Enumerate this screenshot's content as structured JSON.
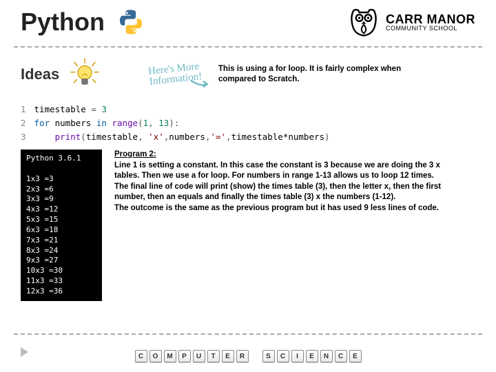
{
  "header": {
    "title": "Python",
    "school": {
      "name": "CARR MANOR",
      "sub": "COMMUNITY SCHOOL"
    }
  },
  "ideas": {
    "label": "Ideas",
    "more_info_line1": "Here's More",
    "more_info_line2": "Information!"
  },
  "note": "This is using a for loop. It is fairly complex when compared to Scratch.",
  "code": {
    "gutter": "1\n2\n3",
    "l1_id": "timestable",
    "l1_eq": " = ",
    "l1_num": "3",
    "l2_for": "for",
    "l2_var": " numbers ",
    "l2_in": "in",
    "l2_sp": " ",
    "l2_range": "range",
    "l2_open": "(",
    "l2_a": "1",
    "l2_comma": ", ",
    "l2_b": "13",
    "l2_close": "):",
    "l3_indent": "    ",
    "l3_print": "print",
    "l3_open": "(",
    "l3_a": "timestable",
    "l3_c1": ", ",
    "l3_s1": "'x'",
    "l3_c2": ",",
    "l3_b": "numbers",
    "l3_c3": ",",
    "l3_s2": "'='",
    "l3_c4": ",",
    "l3_expr": "timestable*numbers",
    "l3_close": ")"
  },
  "terminal": "Python 3.6.1\n\n1x3 =3\n2x3 =6\n3x3 =9\n4x3 =12\n5x3 =15\n6x3 =18\n7x3 =21\n8x3 =24\n9x3 =27\n10x3 =30\n11x3 =33\n12x3 =36",
  "desc": {
    "heading": "Program 2:",
    "p1": "Line 1 is setting a constant. In this case the constant is 3 because we are doing the 3 x tables. Then we use a for loop. For numbers in range 1-13 allows us to loop 12 times.",
    "p2": "The final line of code will print (show) the times table (3), then the letter x, then the first number, then an equals and finally the times table (3) x the numbers (1-12).",
    "p3": "The outcome is the same as the previous program but it has used 9 less lines of code."
  },
  "footer": {
    "keys1": [
      "C",
      "O",
      "M",
      "P",
      "U",
      "T",
      "E",
      "R"
    ],
    "keys2": [
      "S",
      "C",
      "I",
      "E",
      "N",
      "C",
      "E"
    ]
  }
}
